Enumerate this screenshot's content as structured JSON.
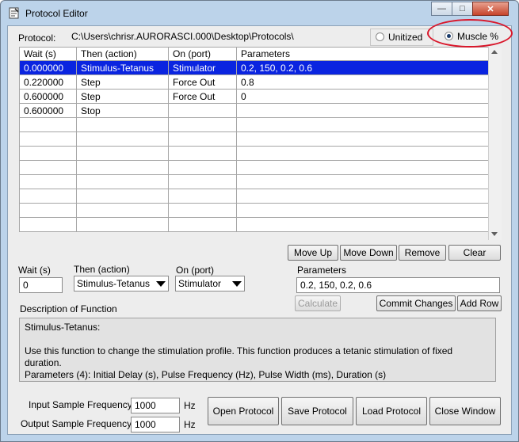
{
  "window": {
    "title": "Protocol Editor",
    "minimize": "—",
    "maximize": "□",
    "close": "✕"
  },
  "protocol": {
    "label": "Protocol:",
    "path": "C:\\Users\\chrisr.AURORASCI.000\\Desktop\\Protocols\\"
  },
  "mode": {
    "unitized_label": "Unitized",
    "muscle_label": "Muscle %",
    "selected": "Muscle %"
  },
  "table": {
    "headers": [
      "Wait (s)",
      "Then (action)",
      "On (port)",
      "Parameters"
    ],
    "rows": [
      [
        "0.000000",
        "Stimulus-Tetanus",
        "Stimulator",
        "0.2, 150, 0.2, 0.6"
      ],
      [
        "0.220000",
        "Step",
        "Force Out",
        "0.8"
      ],
      [
        "0.600000",
        "Step",
        "Force Out",
        "0"
      ],
      [
        "0.600000",
        "Stop",
        "",
        ""
      ],
      [
        "",
        "",
        "",
        ""
      ],
      [
        "",
        "",
        "",
        ""
      ],
      [
        "",
        "",
        "",
        ""
      ],
      [
        "",
        "",
        "",
        ""
      ],
      [
        "",
        "",
        "",
        ""
      ],
      [
        "",
        "",
        "",
        ""
      ],
      [
        "",
        "",
        "",
        ""
      ],
      [
        "",
        "",
        "",
        ""
      ]
    ],
    "selected_row": 0
  },
  "row_buttons": {
    "move_up": "Move Up",
    "move_down": "Move Down",
    "remove": "Remove",
    "clear": "Clear"
  },
  "editor": {
    "wait_label": "Wait (s)",
    "wait_value": "0",
    "action_label": "Then (action)",
    "action_value": "Stimulus-Tetanus",
    "port_label": "On (port)",
    "port_value": "Stimulator",
    "params_label": "Parameters",
    "params_value": "0.2, 150, 0.2, 0.6",
    "calculate": "Calculate",
    "commit": "Commit Changes",
    "add_row": "Add Row"
  },
  "description": {
    "label": "Description of Function",
    "line1": "Stimulus-Tetanus:",
    "line2": "Use this function to change the stimulation profile.  This function produces a tetanic stimulation of fixed",
    "line3": "duration.",
    "line4": "Parameters (4): Initial Delay (s), Pulse Frequency (Hz), Pulse Width (ms), Duration (s)"
  },
  "sampling": {
    "input_label": "Input Sample Frequency",
    "input_value": "1000",
    "input_unit": "Hz",
    "output_label": "Output Sample Frequency",
    "output_value": "1000",
    "output_unit": "Hz"
  },
  "actions": {
    "open": "Open Protocol",
    "save": "Save Protocol",
    "load": "Load Protocol",
    "close": "Close Window"
  },
  "colors": {
    "selection": "#0a24e0",
    "highlight_ellipse": "#d9162a",
    "window_frame": "#bcd3ea"
  }
}
